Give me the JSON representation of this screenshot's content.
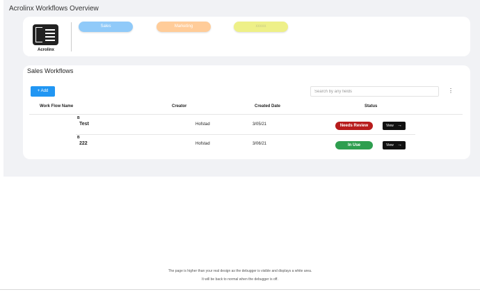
{
  "page": {
    "title": "Acrolinx Workflows Overview"
  },
  "logo": {
    "label": "Acrolinx",
    "icon": "document-icon"
  },
  "pills": [
    {
      "label": "Sales",
      "color": "#90caf9"
    },
    {
      "label": "Marketing",
      "color": "#ffcc99"
    },
    {
      "label": "xxxxx",
      "color": "#eef088"
    }
  ],
  "workflows": {
    "title": "Sales Workflows",
    "add_label": "+ Add",
    "search_placeholder": "Search by any fields",
    "more_icon": "kebab-menu-icon",
    "columns": [
      "Work Flow Name",
      "Creator",
      "Created Date",
      "Status"
    ],
    "rows": [
      {
        "icon": "B",
        "name": "Test",
        "creator": "Hofstad",
        "date": "3/05/21",
        "status": "Needs Review",
        "status_color": "#b71c1c",
        "action": "View"
      },
      {
        "icon": "B",
        "name": "222",
        "creator": "Hofstad",
        "date": "3/06/21",
        "status": "In Use",
        "status_color": "#2e9e4f",
        "action": "View"
      }
    ]
  },
  "debugger": {
    "line1": "The page is higher than your real design as the debugger is visible and displays a white area.",
    "line2": "It will be back to normal when the debugger is off."
  }
}
